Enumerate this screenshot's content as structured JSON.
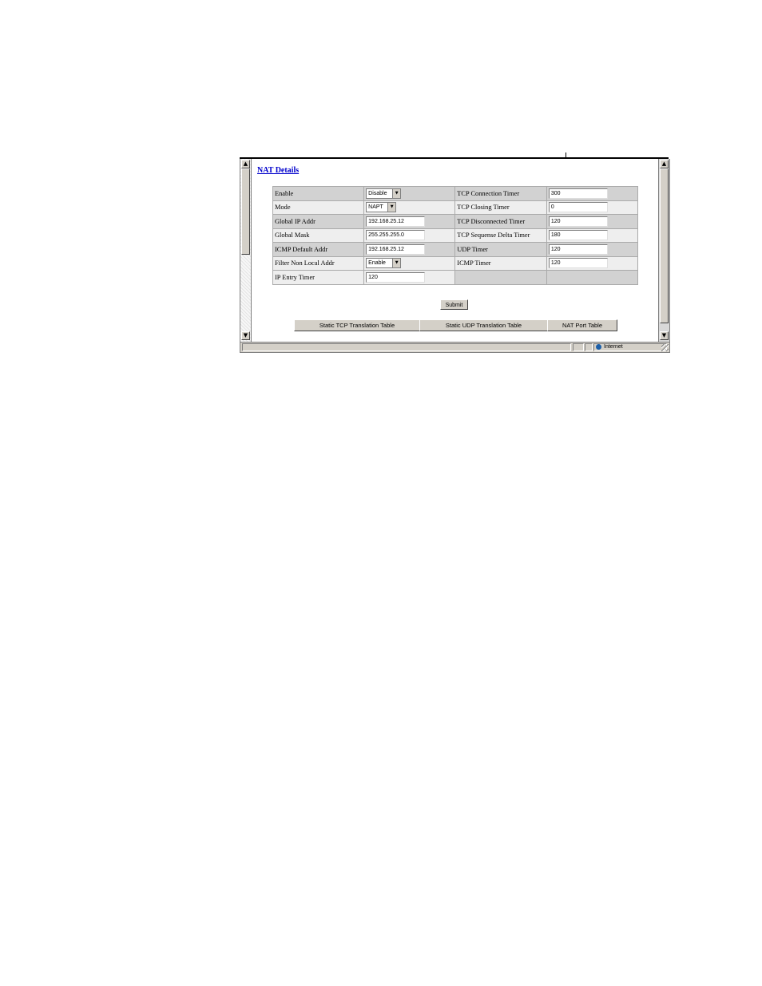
{
  "page": {
    "title": "NAT Details"
  },
  "nat_table": {
    "rows": [
      {
        "left_label": "Enable",
        "left_type": "select",
        "left_value": "Disable",
        "right_label": "TCP Connection Timer",
        "right_value": "300"
      },
      {
        "left_label": "Mode",
        "left_type": "select",
        "left_value": "NAPT",
        "right_label": "TCP Closing Timer",
        "right_value": "0"
      },
      {
        "left_label": "Global IP Addr",
        "left_type": "input",
        "left_value": "192.168.25.12",
        "right_label": "TCP Disconnected Timer",
        "right_value": "120"
      },
      {
        "left_label": "Global Mask",
        "left_type": "input",
        "left_value": "255.255.255.0",
        "right_label": "TCP Sequense Delta Timer",
        "right_value": "180"
      },
      {
        "left_label": "ICMP Default Addr",
        "left_type": "input",
        "left_value": "192.168.25.12",
        "right_label": "UDP Timer",
        "right_value": "120"
      },
      {
        "left_label": "Filter Non Local Addr",
        "left_type": "select",
        "left_value": "Enable",
        "right_label": "ICMP Timer",
        "right_value": "120"
      },
      {
        "left_label": "IP Entry Timer",
        "left_type": "input",
        "left_value": "120"
      }
    ]
  },
  "buttons": {
    "submit": "Submit",
    "static_tcp": "Static TCP Translation Table",
    "static_udp": "Static UDP Translation Table",
    "nat_port": "NAT Port Table"
  },
  "statusbar": {
    "zone": "Internet"
  },
  "icons": {
    "scroll_up": "scroll-up-arrow-icon",
    "scroll_down": "scroll-down-arrow-icon",
    "dropdown": "chevron-down-icon",
    "zone": "globe-icon"
  }
}
